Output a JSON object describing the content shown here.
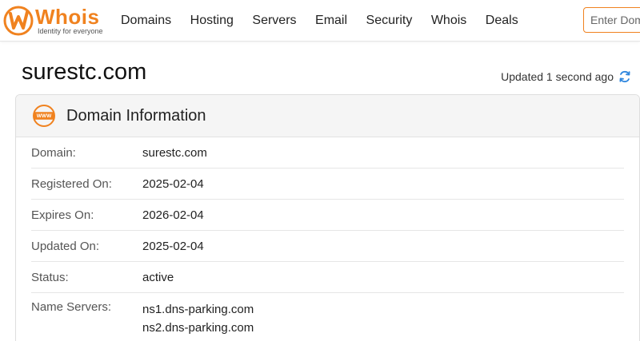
{
  "brand": {
    "name": "Whois",
    "tagline": "Identity for everyone",
    "accent": "#f0821f"
  },
  "nav": {
    "items": [
      "Domains",
      "Hosting",
      "Servers",
      "Email",
      "Security",
      "Whois",
      "Deals"
    ]
  },
  "search": {
    "placeholder": "Enter Domain"
  },
  "page": {
    "title": "surestc.com",
    "updated": "Updated 1 second ago",
    "refresh_icon": "refresh-icon"
  },
  "card": {
    "title": "Domain Information",
    "icon": "www-icon",
    "rows": [
      {
        "label": "Domain:",
        "value": "surestc.com"
      },
      {
        "label": "Registered On:",
        "value": "2025-02-04"
      },
      {
        "label": "Expires On:",
        "value": "2026-02-04"
      },
      {
        "label": "Updated On:",
        "value": "2025-02-04"
      },
      {
        "label": "Status:",
        "value": "active"
      }
    ],
    "name_servers": {
      "label": "Name Servers:",
      "values": [
        "ns1.dns-parking.com",
        "ns2.dns-parking.com"
      ]
    }
  }
}
